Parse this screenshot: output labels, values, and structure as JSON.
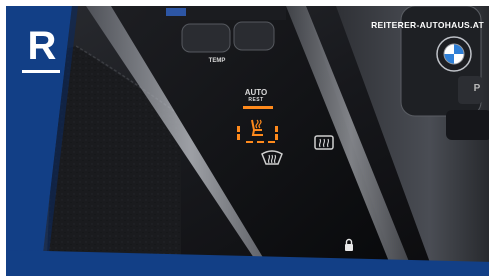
{
  "brand": {
    "logo_letter": "R",
    "website": "REITERER-AUTOHAUS.AT"
  },
  "console": {
    "auto_label": "AUTO",
    "rest_label": "REST",
    "temp_label": "TEMP",
    "gear_park_label": "P"
  },
  "colors": {
    "brand_blue": "#123f86",
    "indicator_orange": "#ff8a1c",
    "console_black": "#0c0d10",
    "trim_silver": "#a9acb2"
  },
  "icons": {
    "seat_heating": "seat-heat-icon",
    "front_defrost": "front-defrost-icon",
    "rear_defrost": "rear-defrost-icon",
    "car_emblem": "bmw-emblem-icon",
    "lock": "lock-icon"
  }
}
